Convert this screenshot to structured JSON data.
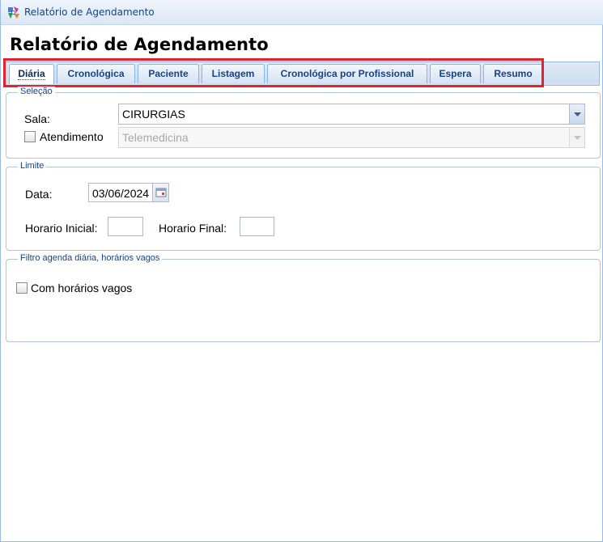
{
  "window": {
    "title": "Relatório de Agendamento"
  },
  "page": {
    "title": "Relatório de Agendamento"
  },
  "tabs": [
    {
      "label": "Diária",
      "active": true
    },
    {
      "label": "Cronológica"
    },
    {
      "label": "Paciente"
    },
    {
      "label": "Listagem"
    },
    {
      "label": "Cronológica por Profissional"
    },
    {
      "label": "Espera"
    },
    {
      "label": "Resumo"
    }
  ],
  "selecao": {
    "legend": "Seleção",
    "sala_label": "Sala:",
    "sala_value": "CIRURGIAS",
    "atendimento_label": "Atendimento",
    "atendimento_checked": false,
    "atendimento_value": "Telemedicina"
  },
  "limite": {
    "legend": "Limite",
    "data_label": "Data:",
    "data_value": "03/06/2024",
    "horario_inicial_label": "Horario Inicial:",
    "horario_inicial_value": "",
    "horario_final_label": "Horario Final:",
    "horario_final_value": ""
  },
  "filtro": {
    "legend": "Filtro agenda diária, horários vagos",
    "horarios_vagos_label": "Com horários vagos",
    "horarios_vagos_checked": false
  },
  "colors": {
    "accent": "#15428b",
    "highlight": "#e5212a",
    "border": "#99bbe8"
  },
  "icons": {
    "app": "app-logo-icon",
    "dropdown": "chevron-down-icon",
    "date": "calendar-icon"
  }
}
